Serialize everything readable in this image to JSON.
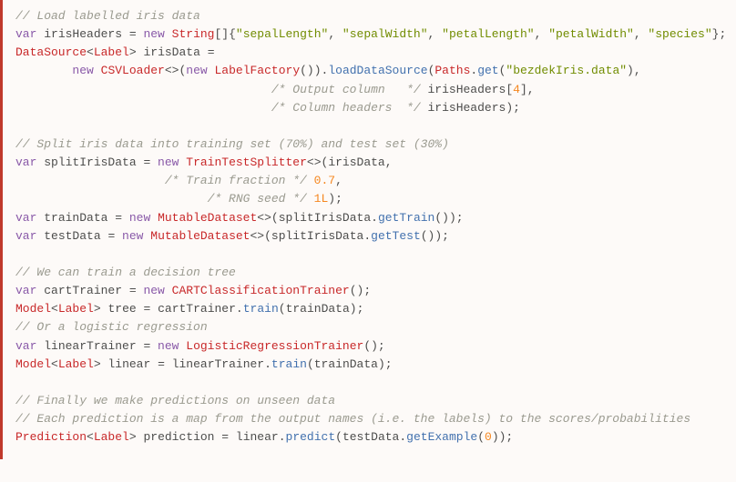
{
  "code": {
    "c_load": "// Load labelled iris data",
    "kw_var": "var",
    "kw_new": "new",
    "id_irisHeaders": "irisHeaders",
    "ty_String": "String",
    "arr_open": "[]{",
    "s_sepalLength": "\"sepalLength\"",
    "s_sepalWidth": "\"sepalWidth\"",
    "s_petalLength": "\"petalLength\"",
    "s_petalWidth": "\"petalWidth\"",
    "s_species": "\"species\"",
    "arr_close": "};",
    "ty_DataSource": "DataSource",
    "lt": "<",
    "gt": ">",
    "ty_Label": "Label",
    "id_irisData": "irisData",
    "eq": " = ",
    "ty_CSVLoader": "CSVLoader",
    "diamond": "<>",
    "lparen": "(",
    "rparen": ")",
    "ty_LabelFactory": "LabelFactory",
    "rparen_dot": ").",
    "fn_loadDataSource": "loadDataSource",
    "ty_Paths": "Paths",
    "dot": ".",
    "fn_get": "get",
    "s_bezdek": "\"bezdekIris.data\"",
    "rparen_comma": "),",
    "c_outputCol": "/* Output column   */",
    "idx4": "[",
    "n4": "4",
    "idx_close": "],",
    "c_colHeaders": "/* Column headers  */",
    "rparen_semi": ");",
    "c_split": "// Split iris data into training set (70%) and test set (30%)",
    "id_splitIrisData": "splitIrisData",
    "ty_TrainTestSplitter": "TrainTestSplitter",
    "comma": ",",
    "c_trainFrac": "/* Train fraction */",
    "n07": "0.7",
    "c_rng": "/* RNG seed */",
    "n1L": "1L",
    "id_trainData": "trainData",
    "ty_MutableDataset": "MutableDataset",
    "fn_getTrain": "getTrain",
    "rrparen_semi": "());",
    "id_testData": "testData",
    "fn_getTest": "getTest",
    "c_tree": "// We can train a decision tree",
    "id_cartTrainer": "cartTrainer",
    "ty_CART": "CARTClassificationTrainer",
    "rparen_semi2": "();",
    "ty_Model": "Model",
    "id_tree": "tree",
    "fn_train": "train",
    "c_logreg": "// Or a logistic regression",
    "id_linearTrainer": "linearTrainer",
    "ty_LogReg": "LogisticRegressionTrainer",
    "id_linear": "linear",
    "c_finally": "// Finally we make predictions on unseen data",
    "c_eachPred": "// Each prediction is a map from the output names (i.e. the labels) to the scores/probabilities",
    "ty_Prediction": "Prediction",
    "id_prediction": "prediction",
    "fn_predict": "predict",
    "fn_getExample": "getExample",
    "n0": "0",
    "rrparen_semi2": "));"
  }
}
